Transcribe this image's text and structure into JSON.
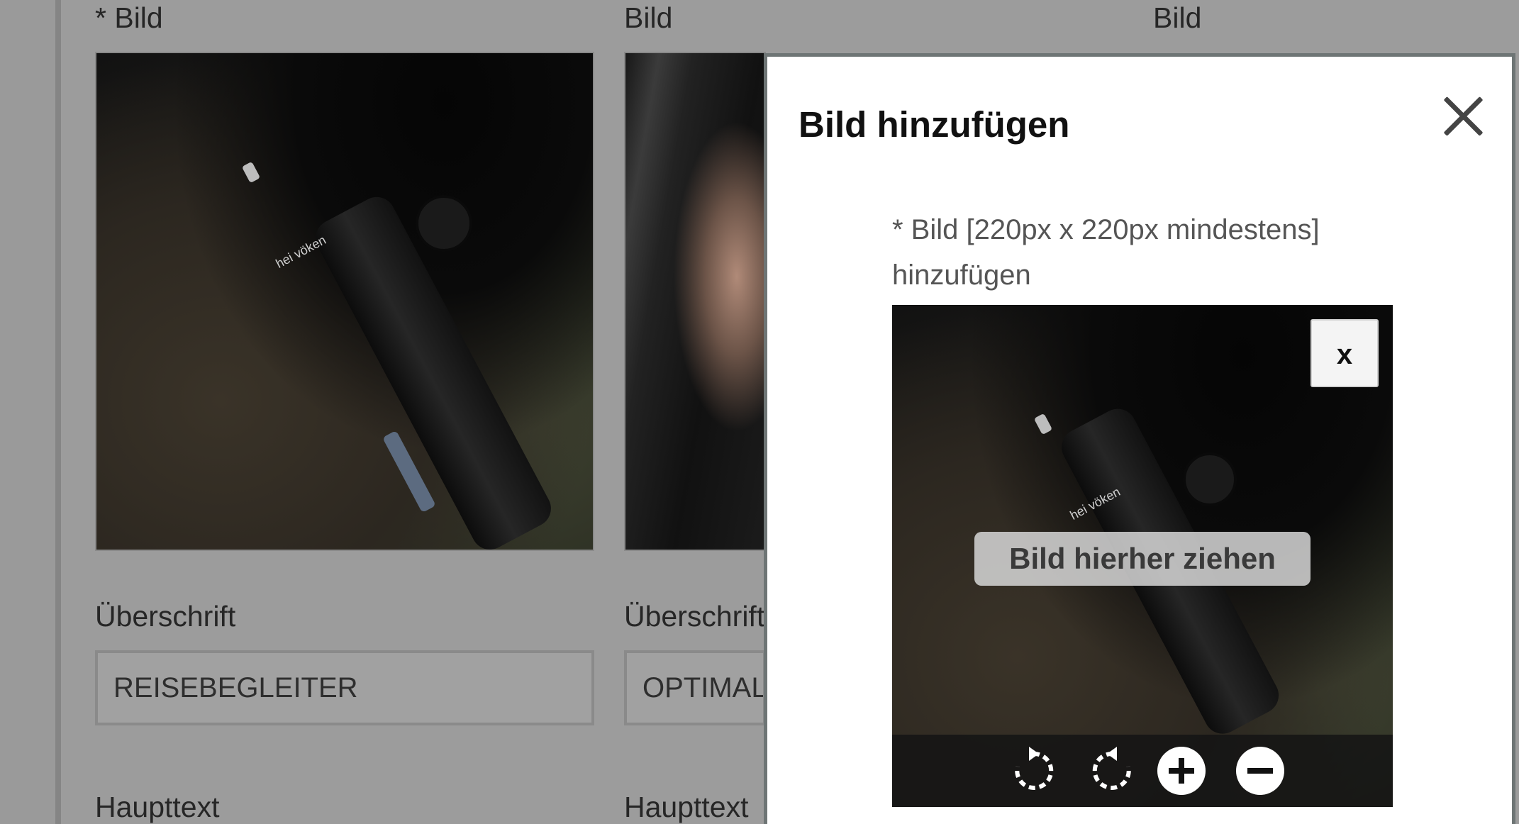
{
  "page": {
    "columns": [
      {
        "image_label": "* Bild",
        "heading_label": "Überschrift",
        "heading_value": "REISEBEGLEITER",
        "body_label": "Haupttext"
      },
      {
        "image_label": "Bild",
        "heading_label": "Überschrift",
        "heading_value": "OPTIMAL",
        "body_label": "Haupttext"
      },
      {
        "image_label": "Bild"
      }
    ],
    "brand_mark": "hei vöken"
  },
  "modal": {
    "title": "Bild hinzufügen",
    "close_icon": "close-icon",
    "upload_label": "* Bild [220px x 220px mindestens] hinzufügen",
    "remove_label": "x",
    "drag_hint": "Bild hierher ziehen",
    "tools": [
      "rotate-clockwise-icon",
      "rotate-counterclockwise-icon",
      "zoom-in-icon",
      "zoom-out-icon"
    ]
  },
  "colors": {
    "overlay_gray": "#9c9c9c",
    "modal_bg": "#ffffff",
    "modal_border": "#6e7575"
  }
}
